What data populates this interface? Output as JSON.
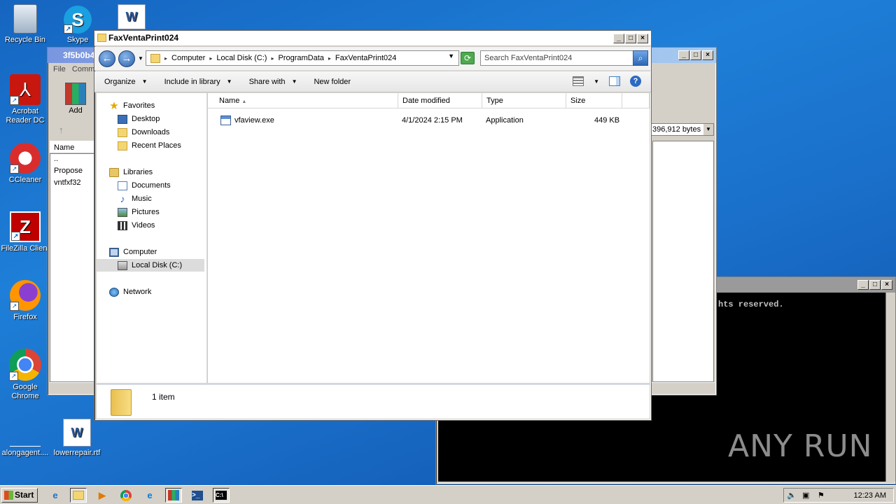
{
  "desktop": {
    "icons": [
      {
        "label": "Recycle Bin"
      },
      {
        "label": "Skype"
      },
      {
        "label": "Acrobat\nReader DC"
      },
      {
        "label": "CCleaner"
      },
      {
        "label": "FileZilla Client"
      },
      {
        "label": "Firefox"
      },
      {
        "label": "Google\nChrome"
      },
      {
        "label": "alongagent...."
      },
      {
        "label": "lowerrepair.rtf"
      }
    ],
    "watermark": "ANY RUN"
  },
  "rar_window": {
    "title": "3f5b0b4",
    "menu_file": "File",
    "menu_comm": "Comm",
    "add_label": "Add",
    "col_name": "Name",
    "files": [
      "..",
      "Propose",
      "vntfxf32"
    ],
    "size_text": "396,912 bytes"
  },
  "console_window": {
    "text": "hts reserved."
  },
  "explorer": {
    "title": "FaxVentaPrint024",
    "breadcrumbs": [
      "Computer",
      "Local Disk (C:)",
      "ProgramData",
      "FaxVentaPrint024"
    ],
    "search_placeholder": "Search FaxVentaPrint024",
    "commands": {
      "organize": "Organize",
      "include_in_library": "Include in library",
      "share_with": "Share with",
      "new_folder": "New folder"
    },
    "nav": {
      "favorites": "Favorites",
      "desktop": "Desktop",
      "downloads": "Downloads",
      "recent": "Recent Places",
      "libraries": "Libraries",
      "documents": "Documents",
      "music": "Music",
      "pictures": "Pictures",
      "videos": "Videos",
      "computer": "Computer",
      "local_disk": "Local Disk (C:)",
      "network": "Network"
    },
    "columns": {
      "name": "Name",
      "date": "Date modified",
      "type": "Type",
      "size": "Size"
    },
    "files": [
      {
        "name": "vfaview.exe",
        "date": "4/1/2024 2:15 PM",
        "type": "Application",
        "size": "449 KB"
      }
    ],
    "status": "1 item"
  },
  "taskbar": {
    "start": "Start",
    "clock": "12:23 AM"
  }
}
